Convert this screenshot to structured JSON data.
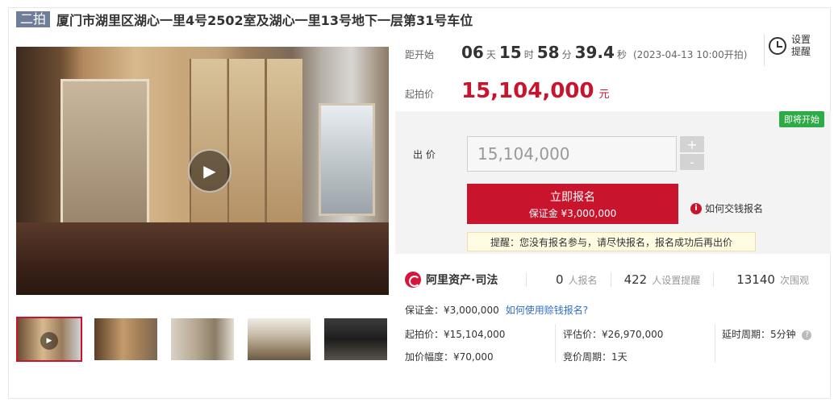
{
  "title": {
    "tag": "二拍",
    "text": "厦门市湖里区湖心一里4号2502室及湖心一里13号地下一层第31号车位"
  },
  "countdown": {
    "label": "距开始",
    "days": "06",
    "days_unit": "天",
    "hours": "15",
    "hours_unit": "时",
    "minutes": "58",
    "minutes_unit": "分",
    "seconds": "39.4",
    "seconds_unit": "秒",
    "start_time": "(2023-04-13 10:00开拍)"
  },
  "remind": {
    "line1": "设置",
    "line2": "提醒",
    "icon": "alarm-clock-icon"
  },
  "start_price": {
    "label": "起拍价",
    "value": "15,104,000",
    "unit": "元"
  },
  "bid": {
    "badge": "即将开始",
    "label": "出 价",
    "value": "15,104,000",
    "plus": "+",
    "minus": "-",
    "signup_main": "立即报名",
    "signup_sub": "保证金 ¥3,000,000",
    "how_pay": "如何交钱报名",
    "notice": "提醒：您没有报名参与，请尽快报名，报名成功后再出价"
  },
  "stats": {
    "brand": "阿里资产·司法",
    "signups": "0",
    "signups_label": "人报名",
    "reminders": "422",
    "reminders_label": "人设置提醒",
    "views": "13140",
    "views_label": "次围观"
  },
  "details": {
    "deposit": "保证金：¥3,000,000",
    "deposit_link": "如何使用赊钱报名?",
    "start_price": "起拍价：¥15,104,000",
    "increment": "加价幅度：¥70,000",
    "appraisal": "评估价：¥26,970,000",
    "bid_period": "竞价周期：1天",
    "delay_period": "延时周期：5分钟"
  },
  "media": {
    "play_icon": "play-icon",
    "help_icon": "?"
  }
}
